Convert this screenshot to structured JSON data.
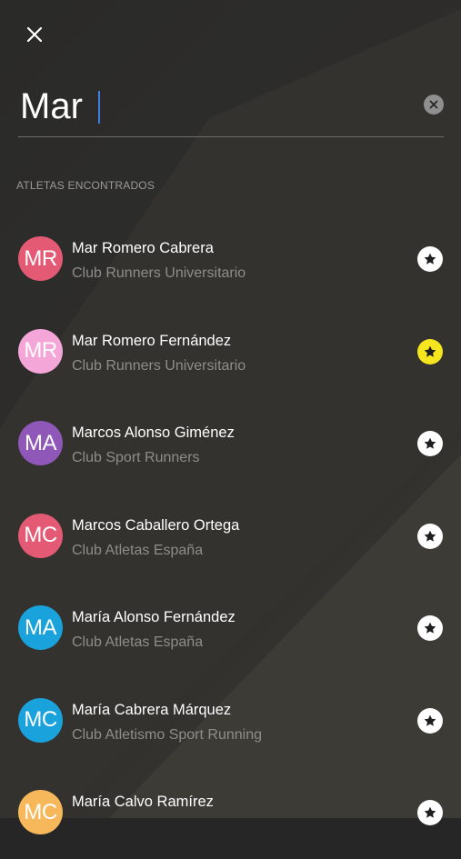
{
  "search": {
    "query": "Mar"
  },
  "section_label": "ATLETAS ENCONTRADOS",
  "athletes": [
    {
      "initials": "MR",
      "name": "Mar Romero Cabrera",
      "club": "Club Runners Universitario",
      "avatar_color": "#e45a74",
      "favorite": false
    },
    {
      "initials": "MR",
      "name": "Mar Romero Fernández",
      "club": "Club Runners Universitario",
      "avatar_color": "#f4a6d8",
      "favorite": true
    },
    {
      "initials": "MA",
      "name": "Marcos Alonso Giménez",
      "club": "Club Sport Runners",
      "avatar_color": "#8f57b8",
      "favorite": false
    },
    {
      "initials": "MC",
      "name": "Marcos Caballero Ortega",
      "club": "Club Atletas España",
      "avatar_color": "#e45a74",
      "favorite": false
    },
    {
      "initials": "MA",
      "name": "María Alonso Fernández",
      "club": "Club Atletas España",
      "avatar_color": "#1aa2dc",
      "favorite": false
    },
    {
      "initials": "MC",
      "name": "María Cabrera Márquez",
      "club": "Club Atletismo Sport Running",
      "avatar_color": "#1aa2dc",
      "favorite": false
    },
    {
      "initials": "MC",
      "name": "María Calvo Ramírez",
      "club": "",
      "avatar_color": "#f6b85a",
      "favorite": false
    }
  ],
  "colors": {
    "favorite_active": "#f5e51e",
    "favorite_inactive": "#ffffff"
  },
  "icons": {
    "close": "close-icon",
    "clear": "clear-icon",
    "favorite": "star-icon"
  }
}
